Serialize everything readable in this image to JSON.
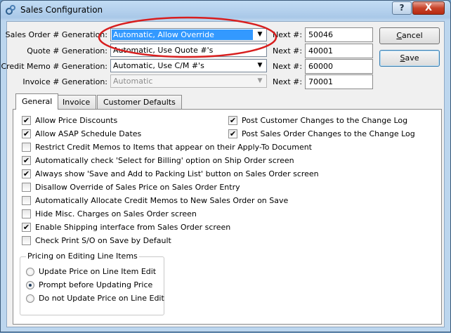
{
  "window": {
    "title": "Sales Configuration",
    "help_label": "?",
    "close_label": "X"
  },
  "generation": [
    {
      "label": "Sales Order # Generation:",
      "value": "Automatic, Allow Override",
      "next_label": "Next #:",
      "next_value": "50046",
      "state": "selected"
    },
    {
      "label": "Quote # Generation:",
      "value": "Automatic, Use Quote #'s",
      "next_label": "Next #:",
      "next_value": "40001",
      "state": "normal"
    },
    {
      "label": "Credit Memo # Generation:",
      "value": "Automatic, Use C/M #'s",
      "next_label": "Next #:",
      "next_value": "60000",
      "state": "normal"
    },
    {
      "label": "Invoice # Generation:",
      "value": "Automatic",
      "next_label": "Next #:",
      "next_value": "70001",
      "state": "disabled"
    }
  ],
  "buttons": {
    "cancel": {
      "pre": "",
      "mnemonic": "C",
      "post": "ancel"
    },
    "save": {
      "pre": "",
      "mnemonic": "S",
      "post": "ave"
    }
  },
  "tabs": [
    {
      "label": "General",
      "active": true
    },
    {
      "label": "Invoice",
      "active": false
    },
    {
      "label": "Customer Defaults",
      "active": false
    }
  ],
  "general": {
    "options_left": [
      {
        "label": "Allow Price Discounts",
        "checked": true
      },
      {
        "label": "Allow ASAP Schedule Dates",
        "checked": true
      },
      {
        "label": "Restrict Credit Memos to Items that appear on their Apply-To Document",
        "checked": false
      },
      {
        "label": "Automatically check 'Select for Billing' option on Ship Order screen",
        "checked": true
      },
      {
        "label": "Always show 'Save and Add to Packing List' button on Sales Order screen",
        "checked": true
      },
      {
        "label": "Disallow Override of Sales Price on Sales Order Entry",
        "checked": false
      },
      {
        "label": "Automatically Allocate Credit Memos to New Sales Order on Save",
        "checked": false
      },
      {
        "label": "Hide Misc. Charges on Sales Order screen",
        "checked": false
      },
      {
        "label": "Enable Shipping interface from Sales Order screen",
        "checked": true
      },
      {
        "label": "Check Print S/O on Save by Default",
        "checked": false
      }
    ],
    "options_right": [
      {
        "label": "Post Customer Changes to the Change Log",
        "checked": true
      },
      {
        "label": "Post Sales Order Changes to the Change Log",
        "checked": true
      }
    ],
    "pricing": {
      "title": "Pricing on Editing Line Items",
      "options": [
        {
          "label": "Update Price on Line Item Edit",
          "selected": false
        },
        {
          "label": "Prompt before Updating Price",
          "selected": true
        },
        {
          "label": "Do not Update Price on Line Edit",
          "selected": false
        }
      ]
    }
  },
  "icons": {
    "app": "gears-icon",
    "dropdown": "chevron-down-icon",
    "checkmark": "✔"
  },
  "colors": {
    "selection": "#3399ff",
    "annotation": "#d81e1e",
    "close": "#c7432a"
  }
}
